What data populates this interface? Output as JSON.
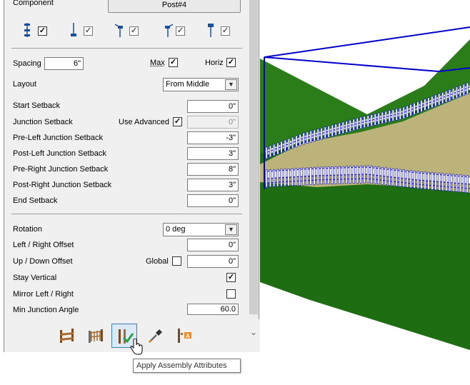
{
  "component": {
    "label": "Component",
    "button": "Post#4"
  },
  "post_types": [
    {
      "name": "post-line-full-icon",
      "checked": true
    },
    {
      "name": "post-bottom-icon",
      "checked": true
    },
    {
      "name": "post-top-left-icon",
      "checked": true
    },
    {
      "name": "post-top-right-icon",
      "checked": true
    },
    {
      "name": "post-top-icon",
      "checked": true
    }
  ],
  "spacing": {
    "label": "Spacing",
    "value": "6\"",
    "max_label": "Max",
    "max_checked": true,
    "horiz_label": "Horiz",
    "horiz_checked": true
  },
  "layout": {
    "label": "Layout",
    "value": "From Middle"
  },
  "setbacks": {
    "start": {
      "label": "Start Setback",
      "value": "0\""
    },
    "junction": {
      "label": "Junction Setback",
      "use_advanced_label": "Use Advanced",
      "use_advanced_checked": true,
      "value": "0\""
    },
    "pre_left": {
      "label": "Pre-Left Junction Setback",
      "value": "-3\""
    },
    "post_left": {
      "label": "Post-Left Junction Setback",
      "value": "3\""
    },
    "pre_right": {
      "label": "Pre-Right Junction Setback",
      "value": "8\""
    },
    "post_right": {
      "label": "Post-Right Junction Setback",
      "value": "3\""
    },
    "end": {
      "label": "End Setback",
      "value": "0\""
    }
  },
  "rotation": {
    "label": "Rotation",
    "value": "0 deg"
  },
  "left_right_offset": {
    "label": "Left / Right Offset",
    "value": "0\""
  },
  "up_down_offset": {
    "label": "Up / Down Offset",
    "global_label": "Global",
    "global_checked": false,
    "value": "0\""
  },
  "stay_vertical": {
    "label": "Stay Vertical",
    "checked": true
  },
  "mirror": {
    "label": "Mirror Left / Right",
    "checked": false
  },
  "min_junction_angle": {
    "label": "Min Junction Angle",
    "value": "60.0"
  },
  "toolbar": {
    "tools": [
      {
        "name": "fence-segment-icon"
      },
      {
        "name": "fence-assembly-icon"
      },
      {
        "name": "apply-assembly-attributes-icon",
        "active": true
      },
      {
        "name": "eyedropper-icon"
      },
      {
        "name": "post-label-icon"
      }
    ],
    "tooltip": "Apply Assembly Attributes"
  },
  "colors": {
    "selection": "#0000cc",
    "terrain_top": "#2d7a1c",
    "terrain_side": "#1f6b14",
    "path": "#b9b07a",
    "fence": "#ffffff"
  }
}
